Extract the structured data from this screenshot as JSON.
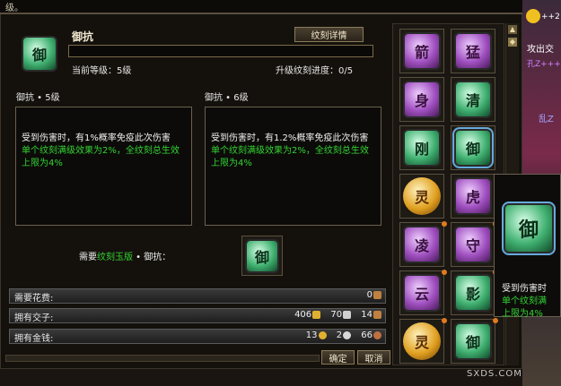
{
  "top_text": "级。",
  "skill": {
    "name": "御抗",
    "detail_button": "纹刻详情",
    "current_level_label": "当前等级：5级",
    "progress_label": "升级纹刻进度：0/5"
  },
  "current": {
    "title": "御抗 • 5级",
    "line1": "受到伤害时，有1%概率免疫此次伤害",
    "line2": "单个纹刻满级效果为2%，全纹刻总生效上限为4%"
  },
  "next": {
    "title": "御抗 • 6级",
    "line1": "受到伤害时，有1.2%概率免疫此次伤害",
    "line2": "单个纹刻满级效果为2%，全纹刻总生效上限为4%"
  },
  "requirement": {
    "prefix": "需要",
    "item": "纹刻玉版",
    "suffix": " • 御抗："
  },
  "costs": {
    "fee_label": "需要花费:",
    "fee_value": "0",
    "jiaozi_label": "拥有交子:",
    "jiaozi_gold": "406",
    "jiaozi_silver": "70",
    "jiaozi_other": "14",
    "money_label": "拥有金钱:",
    "money_gold": "13",
    "money_silver": "2",
    "money_copper": "66"
  },
  "buttons": {
    "confirm": "确定",
    "cancel": "取消"
  },
  "gems": [
    {
      "glyph": "箭",
      "color": "purple"
    },
    {
      "glyph": "猛",
      "color": "purple"
    },
    {
      "glyph": "身",
      "color": "purple"
    },
    {
      "glyph": "清",
      "color": "green"
    },
    {
      "glyph": "刚",
      "color": "green"
    },
    {
      "glyph": "御",
      "color": "green"
    },
    {
      "glyph": "灵",
      "color": "gold"
    },
    {
      "glyph": "虎",
      "color": "purple"
    },
    {
      "glyph": "凌",
      "color": "purple"
    },
    {
      "glyph": "守",
      "color": "purple"
    },
    {
      "glyph": "云",
      "color": "purple"
    },
    {
      "glyph": "影",
      "color": "green"
    },
    {
      "glyph": "灵",
      "color": "gold"
    },
    {
      "glyph": "御",
      "color": "green"
    }
  ],
  "tooltip": {
    "glyph": "御",
    "line1": "受到伤害时",
    "line2": "单个纹刻满",
    "line3": "上限为4%"
  },
  "side": {
    "text1": "++2",
    "text2": "攻出交",
    "text3": "孔Z+++",
    "text4": "乱Z"
  },
  "watermark": "SXDS.COM"
}
